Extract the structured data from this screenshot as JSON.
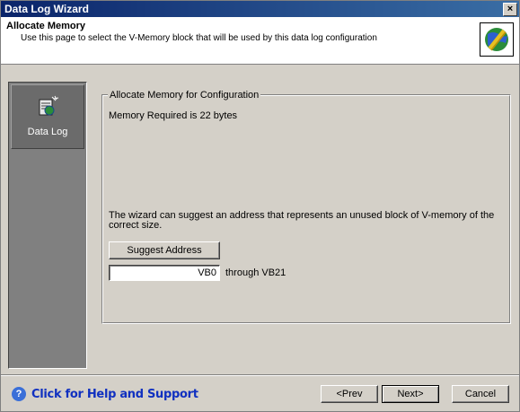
{
  "window": {
    "title": "Data Log Wizard",
    "close_label": "×"
  },
  "header": {
    "title": "Allocate Memory",
    "description": "Use this page to select the V-Memory block that will be used by this data log configuration",
    "icon": "wizard-globe-icon"
  },
  "sidebar": {
    "items": [
      {
        "label": "Data Log",
        "icon": "data-log-icon"
      }
    ]
  },
  "group": {
    "legend": "Allocate Memory for Configuration",
    "memory_required": "Memory Required is 22 bytes",
    "suggest_text": "The wizard can suggest an address that represents an unused block of V-memory of the correct size.",
    "suggest_button": "Suggest Address",
    "address_value": "VB0",
    "through_text": "through VB21"
  },
  "footer": {
    "help_text": "Click for Help and Support",
    "help_icon": "help-question-icon",
    "prev_label": "<Prev",
    "next_label": "Next>",
    "cancel_label": "Cancel"
  },
  "colors": {
    "titlebar": "#0a246a",
    "face": "#d4d0c8",
    "sidebar": "#808080",
    "help_link": "#1030c0"
  }
}
